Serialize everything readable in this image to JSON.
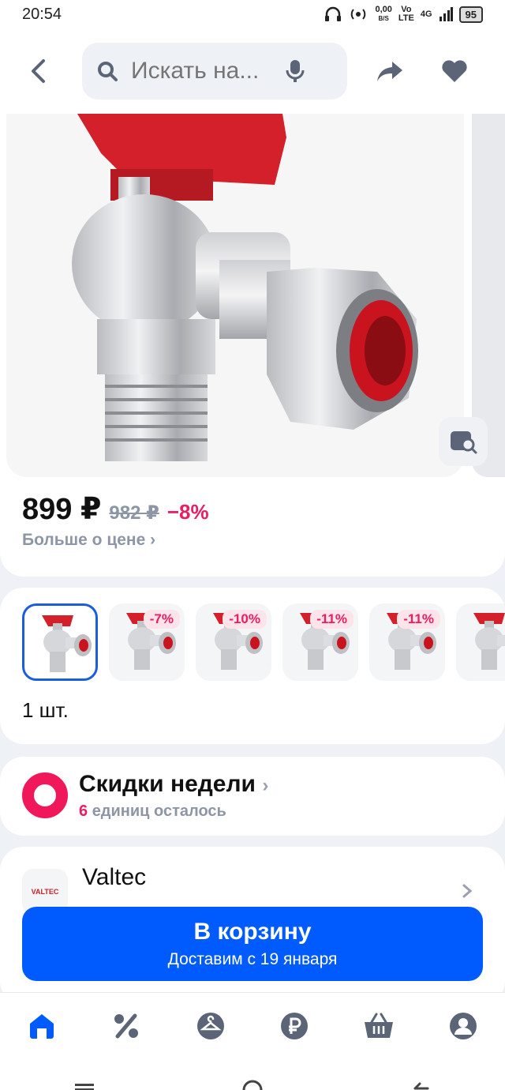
{
  "status_bar": {
    "time": "20:54",
    "net_speed": "0,00",
    "net_unit": "B/S",
    "volte_top": "Vo",
    "volte_bottom": "LTE",
    "network": "4G",
    "battery": "95"
  },
  "header": {
    "search_placeholder": "Искать на..."
  },
  "product": {
    "price": "899 ₽",
    "old_price": "982 ₽",
    "discount": "−8%",
    "more_price_label": "Больше о цене ›"
  },
  "variants": {
    "items": [
      {
        "badge": "",
        "selected": true
      },
      {
        "badge": "-7%"
      },
      {
        "badge": "-10%"
      },
      {
        "badge": "-11%"
      },
      {
        "badge": "-11%"
      },
      {
        "badge": ""
      }
    ],
    "quantity_label": "1 шт."
  },
  "promo": {
    "title": "Скидки недели",
    "count": "6",
    "subtitle": "единиц осталось"
  },
  "brand": {
    "logo_text": "VALTEC",
    "name": "Valtec"
  },
  "cart_button": {
    "title": "В корзину",
    "subtitle": "Доставим с 19 января"
  },
  "colors": {
    "accent": "#005bff",
    "discount": "#e91e63",
    "promo": "#f0185a"
  },
  "bottom_nav": [
    "home-icon",
    "percent-icon",
    "hanger-icon",
    "ruble-icon",
    "basket-icon",
    "profile-icon"
  ]
}
